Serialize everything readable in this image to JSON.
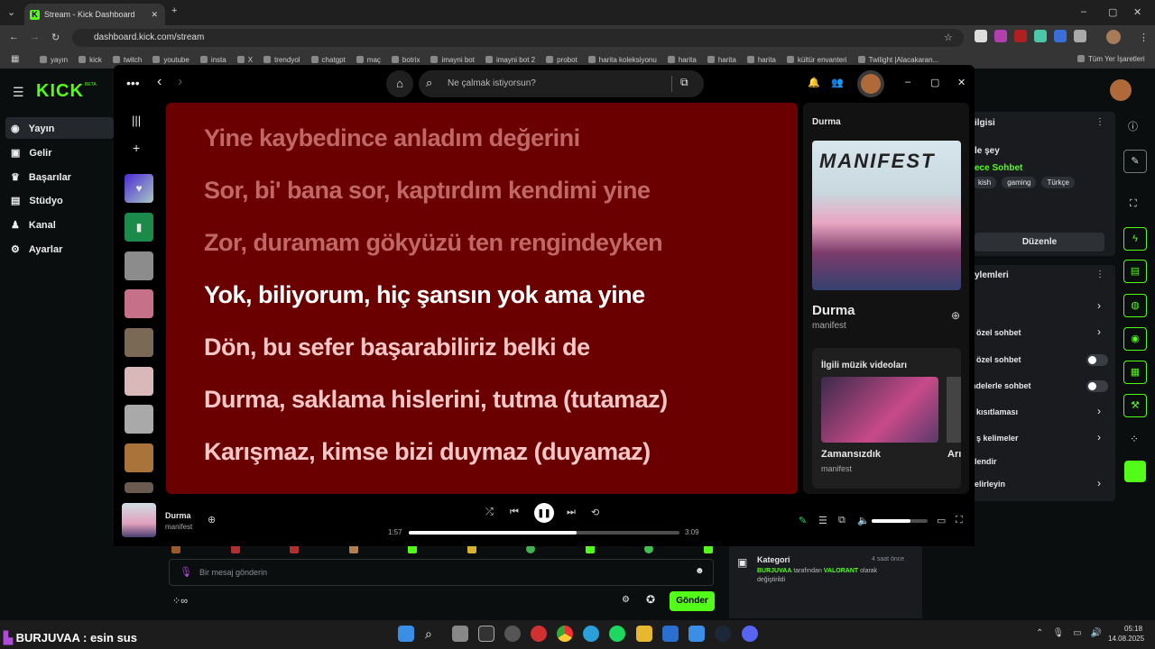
{
  "browser": {
    "tab_title": "Stream - Kick Dashboard",
    "url": "dashboard.kick.com/stream",
    "bookmarks": [
      "yayın",
      "kick",
      "twitch",
      "youtube",
      "insta",
      "X",
      "trendyol",
      "chatgpt",
      "maç",
      "botrix",
      "imayni bot",
      "imayni bot 2",
      "probot",
      "harita koleksiyonu",
      "harita",
      "harita",
      "harita",
      "kültür envanteri",
      "Twilight |Alacakaran..."
    ],
    "all_bookmarks": "Tüm Yer İşaretleri"
  },
  "kick": {
    "logo": "KICK",
    "beta": "BETA",
    "nav": [
      "Yayın",
      "Gelir",
      "Başarılar",
      "Stüdyo",
      "Kanal",
      "Ayarlar"
    ],
    "right_panel": {
      "title_fragment": "ilgisi",
      "line1": "le şey",
      "category": "ece Sohbet",
      "tags": [
        "kish",
        "gaming",
        "Türkçe"
      ],
      "edit_button": "Düzenle",
      "settings_title": "ylemleri",
      "settings": [
        "özel sohbet",
        "özel sohbet",
        "ndelerle sohbet",
        "kısıtlaması",
        "ş kelimeler",
        "lendir",
        "elirleyin"
      ]
    },
    "chat": {
      "placeholder": "Bir mesaj gönderin",
      "send": "Gönder"
    },
    "activity": {
      "title": "Kategori",
      "time": "4 saat önce",
      "user": "BURJUVAA",
      "text1": " tarafından ",
      "game": "VALORANT",
      "text2": " olarak",
      "text3": "değiştirildi"
    }
  },
  "spotify": {
    "search_placeholder": "Ne çalmak istiyorsun?",
    "lyrics_past": [
      "Yine kaybedince anladım değerini",
      "Sor, bi' bana sor, kaptırdım kendimi yine",
      "Zor, duramam gökyüzü ten rengindeyken"
    ],
    "lyrics_current": "Yok, biliyorum, hiç şansın yok ama yine",
    "lyrics_next": [
      "Dön, bu sefer başarabiliriz belki de",
      "Durma, saklama hislerini, tutma (tutamaz)",
      "Karışmaz, kimse bizi duymaz (duyamaz)"
    ],
    "now_playing": {
      "panel_title": "Durma",
      "cover_text": "MANIFEST",
      "track": "Durma",
      "artist": "manifest",
      "related_title": "İlgili müzik videoları",
      "video_title": "Zamansızdık",
      "video_artist": "manifest",
      "video2_fragment": "Arı"
    },
    "player": {
      "track": "Durma",
      "artist": "manifest",
      "elapsed": "1:57",
      "total": "3:09",
      "progress": 0.62,
      "volume": 0.7
    }
  },
  "overlay_text": "BURJUVAA : esin sus",
  "taskbar": {
    "time": "05:18",
    "date": "14.08.2025"
  },
  "colors": {
    "kick_green": "#53fc18",
    "lyrics_bg": "#6b0000",
    "past_lyric": "#c06868",
    "next_lyric": "#f7c6c6"
  }
}
